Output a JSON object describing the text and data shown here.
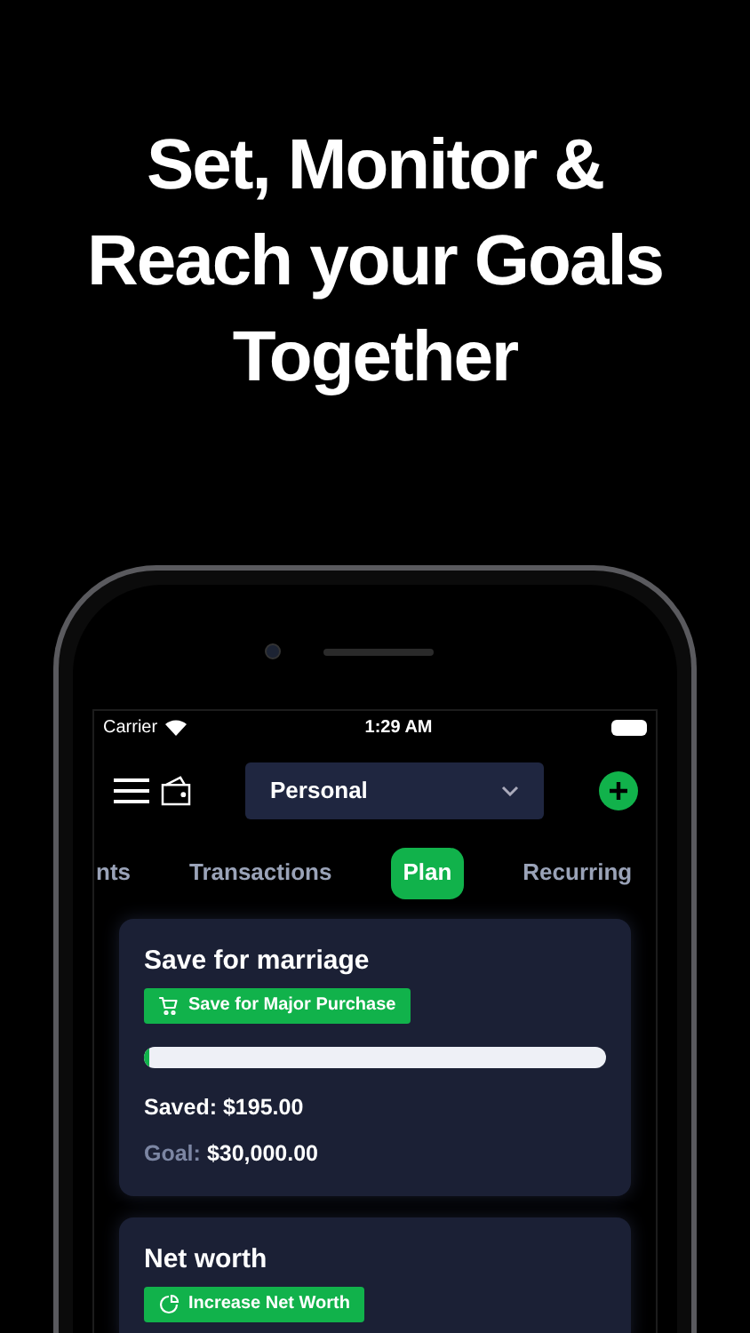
{
  "headline": [
    "Set, Monitor &",
    "Reach your Goals",
    "Together"
  ],
  "status_bar": {
    "carrier": "Carrier",
    "time": "1:29 AM"
  },
  "header": {
    "account": "Personal"
  },
  "tabs": [
    {
      "label": "nts",
      "selected": false
    },
    {
      "label": "Transactions",
      "selected": false
    },
    {
      "label": "Plan",
      "selected": true
    },
    {
      "label": "Recurring",
      "selected": false
    }
  ],
  "goals": [
    {
      "title": "Save for marriage",
      "kind": "purchase",
      "tag": "Save for Major Purchase",
      "level": 0.01,
      "saved_label": "Saved:",
      "saved": "$195.00",
      "goal_label": "Goal:",
      "goal": "$30,000.00"
    },
    {
      "title": "Net worth",
      "kind": "net_worth",
      "tag": "Increase Net Worth"
    }
  ]
}
